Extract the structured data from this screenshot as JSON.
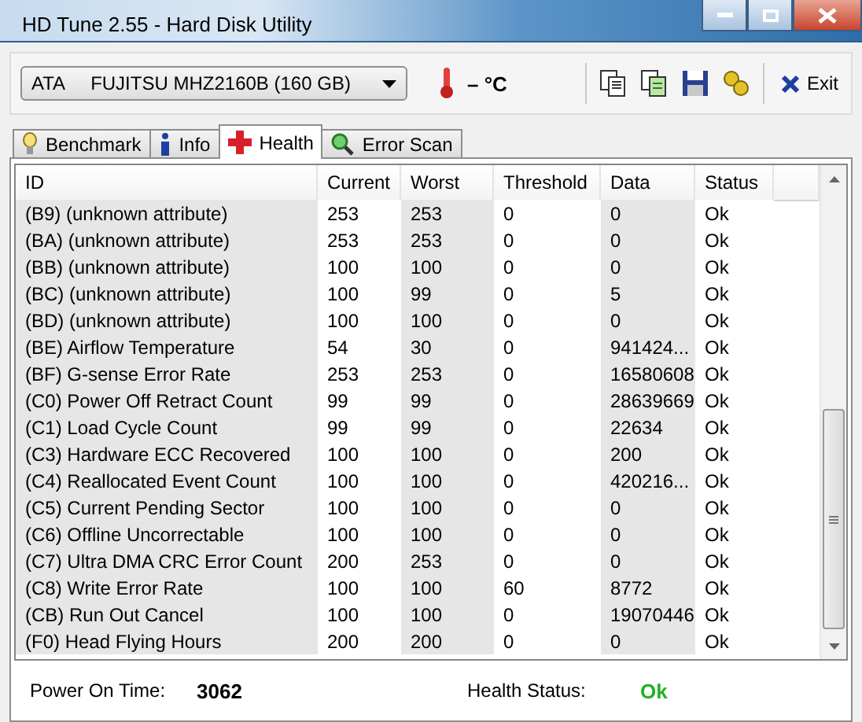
{
  "window": {
    "title": "HD Tune 2.55 - Hard Disk Utility"
  },
  "toolbar": {
    "drive": "ATA     FUJITSU MHZ2160B (160 GB)",
    "temperature": "– °C",
    "exit": "Exit"
  },
  "tabs": [
    {
      "label": "Benchmark",
      "kind": "bulb",
      "selected": false
    },
    {
      "label": "Info",
      "kind": "info",
      "selected": false
    },
    {
      "label": "Health",
      "kind": "cross",
      "selected": true
    },
    {
      "label": "Error Scan",
      "kind": "magnifier",
      "selected": false
    }
  ],
  "table": {
    "columns": [
      "ID",
      "Current",
      "Worst",
      "Threshold",
      "Data",
      "Status"
    ],
    "rows": [
      [
        "(B9) (unknown attribute)",
        "253",
        "253",
        "0",
        "0",
        "Ok"
      ],
      [
        "(BA) (unknown attribute)",
        "253",
        "253",
        "0",
        "0",
        "Ok"
      ],
      [
        "(BB) (unknown attribute)",
        "100",
        "100",
        "0",
        "0",
        "Ok"
      ],
      [
        "(BC) (unknown attribute)",
        "100",
        "99",
        "0",
        "5",
        "Ok"
      ],
      [
        "(BD) (unknown attribute)",
        "100",
        "100",
        "0",
        "0",
        "Ok"
      ],
      [
        "(BE) Airflow Temperature",
        "54",
        "30",
        "0",
        "941424...",
        "Ok"
      ],
      [
        "(BF) G-sense Error Rate",
        "253",
        "253",
        "0",
        "16580608",
        "Ok"
      ],
      [
        "(C0) Power Off Retract Count",
        "99",
        "99",
        "0",
        "28639669",
        "Ok"
      ],
      [
        "(C1) Load Cycle Count",
        "99",
        "99",
        "0",
        "22634",
        "Ok"
      ],
      [
        "(C3) Hardware ECC Recovered",
        "100",
        "100",
        "0",
        "200",
        "Ok"
      ],
      [
        "(C4) Reallocated Event Count",
        "100",
        "100",
        "0",
        "420216...",
        "Ok"
      ],
      [
        "(C5) Current Pending Sector",
        "100",
        "100",
        "0",
        "0",
        "Ok"
      ],
      [
        "(C6) Offline Uncorrectable",
        "100",
        "100",
        "0",
        "0",
        "Ok"
      ],
      [
        "(C7) Ultra DMA CRC Error Count",
        "200",
        "253",
        "0",
        "0",
        "Ok"
      ],
      [
        "(C8) Write Error Rate",
        "100",
        "100",
        "60",
        "8772",
        "Ok"
      ],
      [
        "(CB) Run Out Cancel",
        "100",
        "100",
        "0",
        "19070446",
        "Ok"
      ],
      [
        "(F0) Head Flying Hours",
        "200",
        "200",
        "0",
        "0",
        "Ok"
      ]
    ]
  },
  "footer": {
    "power_on_label": "Power On Time:",
    "power_on_value": "3062",
    "health_label": "Health Status:",
    "health_value": "Ok"
  }
}
